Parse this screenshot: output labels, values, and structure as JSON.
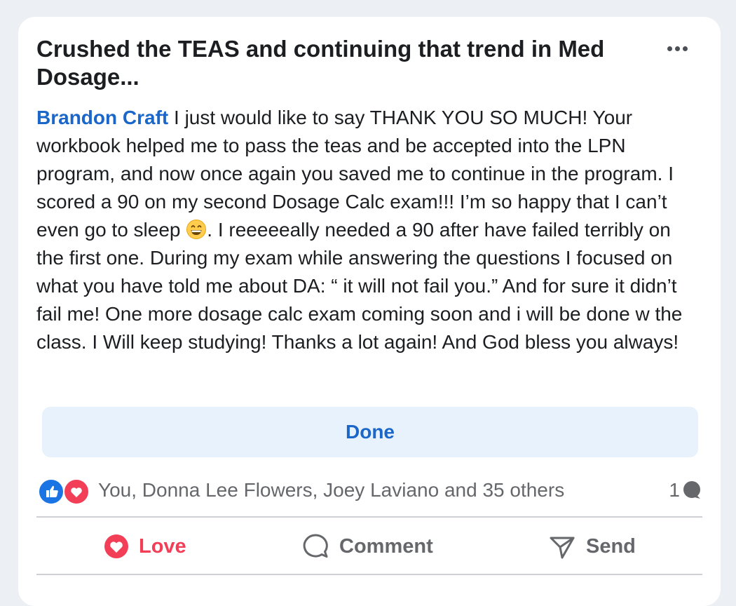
{
  "post": {
    "title": "Crushed the TEAS and continuing that trend in Med Dosage...",
    "author": "Brandon Craft",
    "text_part1": " I just would like to say THANK YOU SO MUCH! Your workbook helped me to pass the teas and be accepted into the LPN program, and now once again you saved me to continue in the program. I scored a 90 on my second Dosage Calc exam!!! I’m so happy that I can’t even go to sleep ",
    "text_part2": ". I reeeeeally needed a 90 after have failed terribly on the first one. During my exam while answering the questions I focused on what you have told me about DA: “ it will not fail you.” And for sure it didn’t fail me! One more dosage calc exam coming soon and i will be done w the class. I Will keep studying! Thanks a lot again! And God bless you always!",
    "emoji": "grinning-face-icon"
  },
  "done_button": {
    "label": "Done"
  },
  "reactions": {
    "icons": [
      "like-icon",
      "heart-icon"
    ],
    "names": "You, Donna Lee Flowers, Joey Laviano and 35 others",
    "comment_count": "1"
  },
  "actions": {
    "love_label": "Love",
    "comment_label": "Comment",
    "send_label": "Send"
  },
  "colors": {
    "accent": "#1b66c9",
    "love": "#f33e58",
    "like": "#1b74e4",
    "muted": "#65676b",
    "done_bg": "#e8f2fc"
  }
}
